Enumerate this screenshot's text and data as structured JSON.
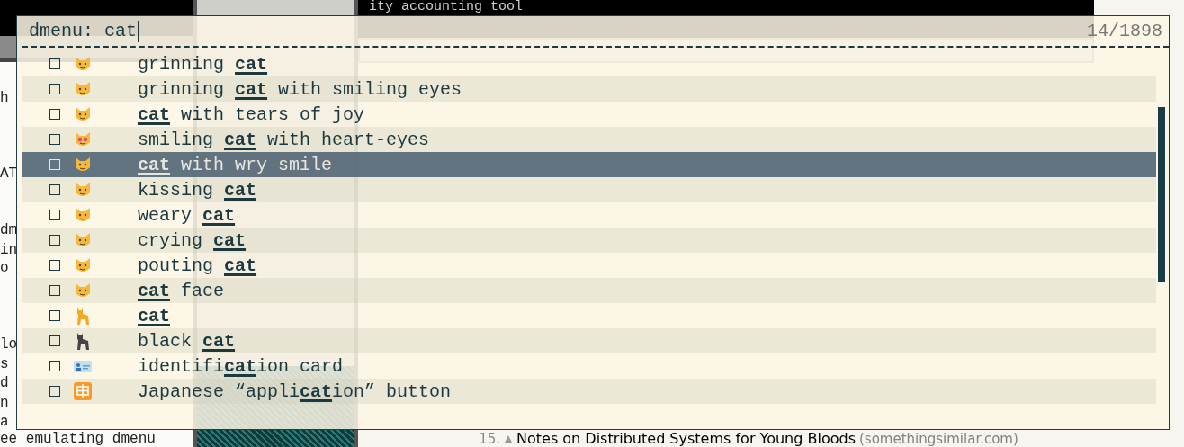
{
  "terminal": {
    "lines": [
      "h",
      "AT",
      "dm",
      "in",
      "o",
      "lo",
      "s",
      "d",
      "n",
      "a",
      "ee emulating dmenu"
    ]
  },
  "top_bar": {
    "text": "ity accounting tool"
  },
  "stories": [
    {
      "rank": "15.",
      "title": "Notes on Distributed Systems for Young Bloods",
      "domain": "(somethingsimilar.com)"
    }
  ],
  "dmenu": {
    "prompt": "dmenu:",
    "query": "cat",
    "counter": "14/1898",
    "items": [
      {
        "kind": "cat-face",
        "label": "grinning **cat**",
        "checked": false,
        "selected": false
      },
      {
        "kind": "cat-face",
        "label": "grinning **cat** with smiling eyes",
        "checked": false,
        "selected": false
      },
      {
        "kind": "cat-face",
        "label": "**cat** with tears of joy",
        "checked": false,
        "selected": false
      },
      {
        "kind": "heart-eyes",
        "label": "smiling **cat** with heart-eyes",
        "checked": false,
        "selected": false
      },
      {
        "kind": "cat-face",
        "label": "**cat** with wry smile",
        "checked": false,
        "selected": true
      },
      {
        "kind": "cat-face",
        "label": "kissing **cat**",
        "checked": false,
        "selected": false
      },
      {
        "kind": "cat-face",
        "label": "weary **cat**",
        "checked": false,
        "selected": false
      },
      {
        "kind": "cat-face",
        "label": "crying **cat**",
        "checked": false,
        "selected": false
      },
      {
        "kind": "cat-face",
        "label": "pouting **cat**",
        "checked": false,
        "selected": false
      },
      {
        "kind": "cat-face",
        "label": "**cat** face",
        "checked": false,
        "selected": false
      },
      {
        "kind": "cat",
        "label": "**cat**",
        "checked": false,
        "selected": false
      },
      {
        "kind": "black-cat",
        "label": "black **cat**",
        "checked": false,
        "selected": false
      },
      {
        "kind": "id-card",
        "label": "identifi**cat**ion card",
        "checked": false,
        "selected": false
      },
      {
        "kind": "orange-square",
        "label": "Japanese “appli**cat**ion” button",
        "checked": false,
        "selected": false
      }
    ]
  }
}
